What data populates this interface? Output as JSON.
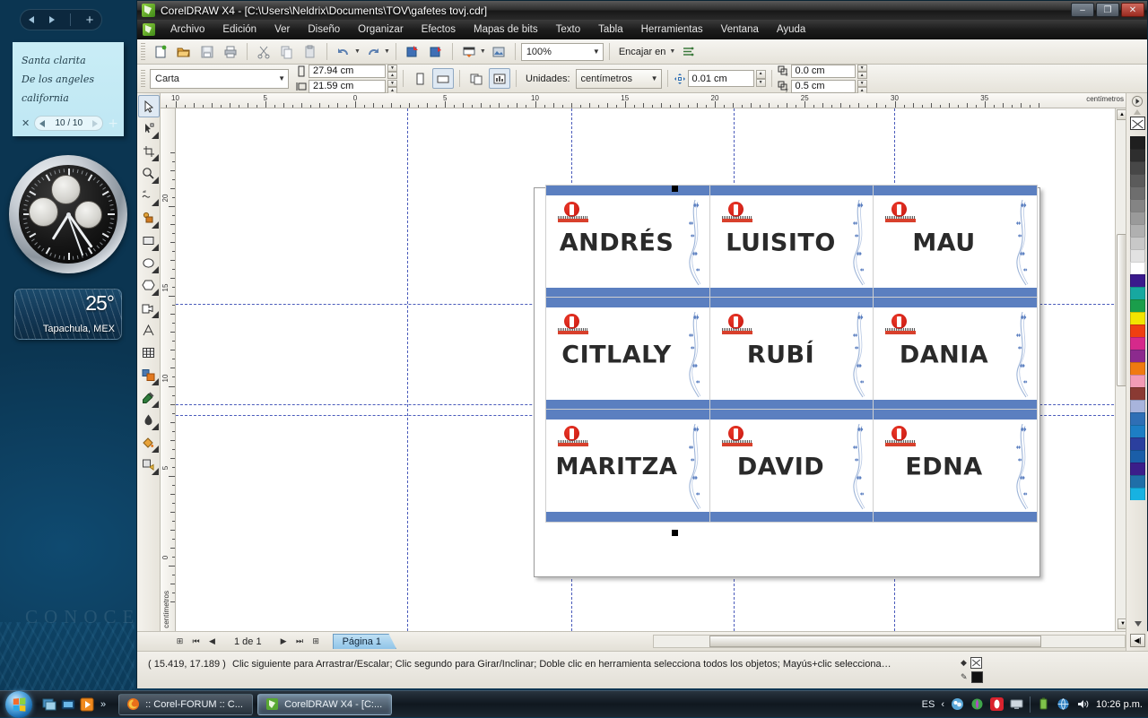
{
  "window": {
    "title": "CorelDRAW X4 - [C:\\Users\\Neldrix\\Documents\\TOV\\gafetes tovj.cdr]",
    "minimize_label": "–",
    "maximize_label": "❐",
    "close_label": "✕"
  },
  "menu": {
    "items": [
      {
        "label": "Archivo"
      },
      {
        "label": "Edición"
      },
      {
        "label": "Ver"
      },
      {
        "label": "Diseño"
      },
      {
        "label": "Organizar"
      },
      {
        "label": "Efectos"
      },
      {
        "label": "Mapas de bits"
      },
      {
        "label": "Texto"
      },
      {
        "label": "Tabla"
      },
      {
        "label": "Herramientas"
      },
      {
        "label": "Ventana"
      },
      {
        "label": "Ayuda"
      }
    ]
  },
  "standard_toolbar": {
    "buttons": [
      {
        "name": "new-document",
        "glyph": "🗋"
      },
      {
        "name": "open-document",
        "glyph": "📁"
      },
      {
        "name": "save-document",
        "glyph": "💾"
      },
      {
        "name": "print-document",
        "glyph": "🖨"
      },
      {
        "name": "cut",
        "glyph": "✂"
      },
      {
        "name": "copy",
        "glyph": "⧉"
      },
      {
        "name": "paste",
        "glyph": "📋"
      },
      {
        "name": "undo",
        "glyph": "↶"
      },
      {
        "name": "redo",
        "glyph": "↷"
      },
      {
        "name": "import",
        "glyph": "⬇"
      },
      {
        "name": "export",
        "glyph": "⬆"
      },
      {
        "name": "application-launcher",
        "glyph": "🖥"
      },
      {
        "name": "corel-online",
        "glyph": "🖼"
      }
    ],
    "zoom_level": "100%",
    "snap_label": "Encajar en"
  },
  "property_bar": {
    "paper_type": "Carta",
    "paper_width": "27.94 cm",
    "paper_height": "21.59 cm",
    "orientation_portrait": "portrait-icon",
    "orientation_landscape": "landscape-icon",
    "all_pages": "all-pages-icon",
    "current_page": "current-page-icon",
    "units_label": "Unidades:",
    "units_value": "centímetros",
    "nudge_value": "0.01 cm",
    "duplicate_x": "0.0 cm",
    "duplicate_y": "0.5 cm"
  },
  "toolbox": {
    "tools": [
      {
        "name": "pick-tool",
        "glyph": "➤",
        "active": true
      },
      {
        "name": "shape-tool",
        "glyph": "✒"
      },
      {
        "name": "crop-tool",
        "glyph": "✀"
      },
      {
        "name": "zoom-tool",
        "glyph": "🔍"
      },
      {
        "name": "freehand-tool",
        "glyph": "✧"
      },
      {
        "name": "smart-fill-tool",
        "glyph": "◩"
      },
      {
        "name": "rectangle-tool",
        "glyph": "▭"
      },
      {
        "name": "ellipse-tool",
        "glyph": "○"
      },
      {
        "name": "polygon-tool",
        "glyph": "⬡"
      },
      {
        "name": "basic-shapes-tool",
        "glyph": "⬠"
      },
      {
        "name": "text-tool",
        "glyph": "A"
      },
      {
        "name": "table-tool",
        "glyph": "▦"
      },
      {
        "name": "blend-tool",
        "glyph": "❐"
      },
      {
        "name": "eyedropper-tool",
        "glyph": "✎"
      },
      {
        "name": "outline-tool",
        "glyph": "⬤"
      },
      {
        "name": "fill-tool",
        "glyph": "◆"
      },
      {
        "name": "interactive-fill-tool",
        "glyph": "◧"
      }
    ]
  },
  "rulers": {
    "unit_label": "centímetros",
    "horizontal_ticks": [
      "10",
      "5",
      "0",
      "5",
      "10",
      "15",
      "20",
      "25",
      "30",
      "35"
    ],
    "vertical_ticks": [
      "20",
      "15",
      "10",
      "5",
      "0"
    ]
  },
  "canvas": {
    "badges": [
      {
        "name": "ANDRÉS"
      },
      {
        "name": "LUISITO"
      },
      {
        "name": "MAU"
      },
      {
        "name": "CITLALY"
      },
      {
        "name": "RUBÍ"
      },
      {
        "name": "DANIA"
      },
      {
        "name": "MARITZA"
      },
      {
        "name": "DAVID"
      },
      {
        "name": "EDNA"
      }
    ],
    "badge_bar_color": "#5b7fc0",
    "badge_text_color": "#2a2a2a",
    "logo_color": "#d8402c"
  },
  "page_navigator": {
    "page_count_label": "1 de 1",
    "page_tab_label": "Página 1",
    "first_label": "⏮",
    "prev_label": "◀",
    "next_label": "▶",
    "last_label": "⏭",
    "add_page_before": "⊞",
    "add_page_after": "⊞"
  },
  "status_bar": {
    "coordinates": "( 15.419, 17.189 )",
    "hint": "Clic siguiente para Arrastrar/Escalar; Clic segundo para Girar/Inclinar; Doble clic en herramienta selecciona todos los objetos; Mayús+clic selecciona…",
    "fill_label": "fill-none-swatch",
    "outline_label": "outline-black-swatch"
  },
  "palette": {
    "none_swatch": "none-swatch",
    "colors": [
      "#1f1f1f",
      "#2e2e2e",
      "#474747",
      "#5b5b5b",
      "#6e6e6e",
      "#848484",
      "#9a9a9a",
      "#b0b0b0",
      "#c8c8c8",
      "#e2e2e2",
      "#ffffff",
      "#3a1a8c",
      "#17a8a0",
      "#1a9e4b",
      "#f2e500",
      "#f03f12",
      "#d6298b",
      "#8c2a8e",
      "#f07a10",
      "#f29bb5",
      "#8a3a33",
      "#a8b4dc",
      "#2f6fb5",
      "#1d7ec4",
      "#2b3f9e",
      "#1a5ea8",
      "#3b1e8a",
      "#1f6fa8",
      "#17b2e2"
    ]
  },
  "desktop": {
    "watermark": "CONOCE",
    "sticky_note": {
      "lines": [
        "Santa clarita",
        "De los angeles",
        "california"
      ],
      "pager": "10 / 10",
      "close_label": "✕",
      "add_label": "+"
    },
    "weather": {
      "temperature": "25°",
      "city": "Tapachula, MEX"
    },
    "gadget_nav": {
      "prev": "prev-gadget-icon",
      "next": "next-gadget-icon",
      "add": "+"
    }
  },
  "taskbar": {
    "start_label": "start-orb",
    "quick_launch": [
      {
        "name": "show-desktop-icon"
      },
      {
        "name": "switch-windows-icon"
      },
      {
        "name": "media-player-icon"
      }
    ],
    "chevrons": "»",
    "tasks": [
      {
        "label": ":: Corel-FORUM :: C...",
        "icon": "firefox-icon",
        "active": false
      },
      {
        "label": "CorelDRAW X4 - [C:...",
        "icon": "coreldraw-icon",
        "active": true
      }
    ],
    "tray": {
      "language": "ES",
      "expand": "‹",
      "icons": [
        "messenger-icon",
        "antivirus-icon",
        "opera-icon",
        "monitor-icon",
        "battery-icon",
        "network-icon",
        "volume-icon"
      ],
      "clock": "10:26 p.m."
    }
  }
}
